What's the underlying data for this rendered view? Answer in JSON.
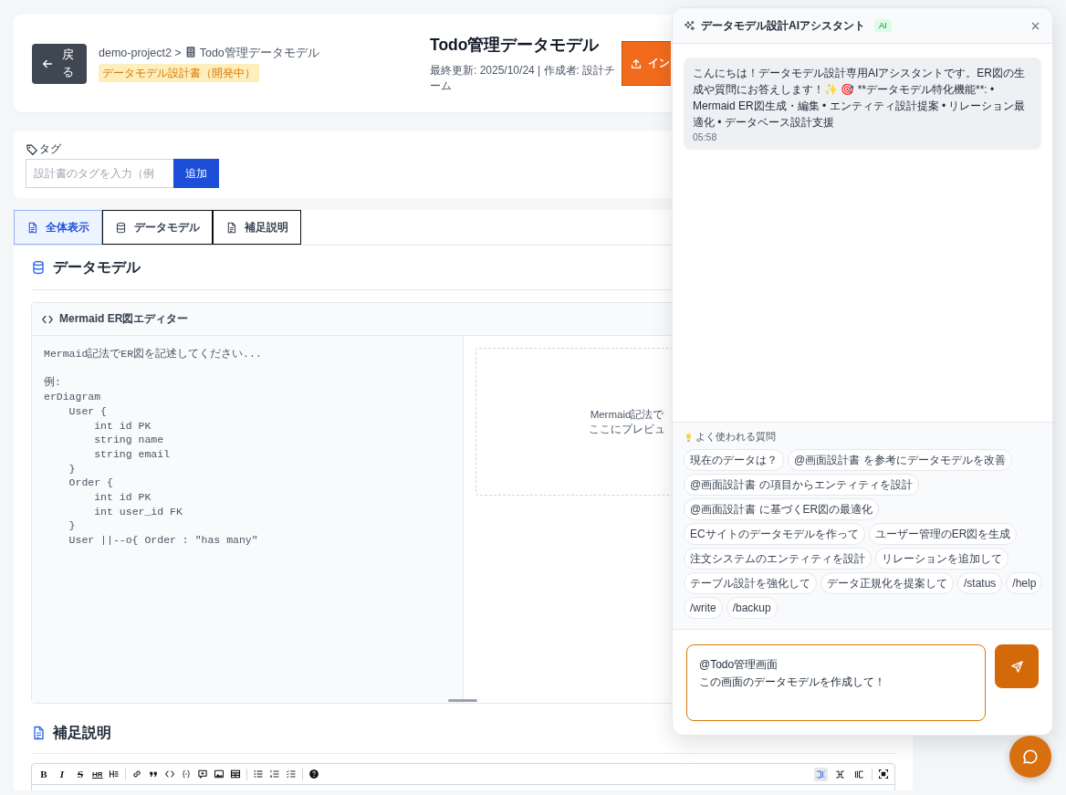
{
  "header": {
    "back_button": "戻る",
    "breadcrumb": {
      "project": "demo-project2 >",
      "document": "Todo管理データモデル"
    },
    "status_badge": "データモデル設計書（開発中）",
    "title": "Todo管理データモデル",
    "meta": "最終更新: 2025/10/24 | 作成者: 設計チーム",
    "export_button": "イン"
  },
  "tags": {
    "label": "タグ",
    "input": {
      "placeholder": "設計書のタグを入力（例"
    },
    "add_button": "追加"
  },
  "tabs": [
    {
      "label": "全体表示",
      "kind": "document",
      "selected": true
    },
    {
      "label": "データモデル",
      "kind": "database",
      "selected": false
    },
    {
      "label": "補足説明",
      "kind": "document",
      "selected": false
    }
  ],
  "data_model": {
    "heading": "データモデル",
    "editor_title": "Mermaid ER図エディター",
    "code": {
      "placeholder": "Mermaid記法でER図を記述してください...\n\n例:\nerDiagram\n    User {\n        int id PK\n        string name\n        string email\n    }\n    Order {\n        int id PK\n        int user_id FK\n    }\n    User ||--o{ Order : \"has many\""
    },
    "preview_lines": [
      "Mermaid記法で",
      "ここにプレビュ"
    ]
  },
  "notes": {
    "heading": "補足説明",
    "toolbar": [
      {
        "kind": "bold",
        "label": "B"
      },
      {
        "kind": "italic",
        "label": "I"
      },
      {
        "kind": "strike",
        "label": "S"
      },
      {
        "kind": "hr",
        "label": "HR"
      },
      {
        "kind": "heading"
      },
      {
        "kind": "divider"
      },
      {
        "kind": "link"
      },
      {
        "kind": "quote"
      },
      {
        "kind": "code"
      },
      {
        "kind": "codeblock"
      },
      {
        "kind": "comment"
      },
      {
        "kind": "image"
      },
      {
        "kind": "table"
      },
      {
        "kind": "divider"
      },
      {
        "kind": "list"
      },
      {
        "kind": "ordered"
      },
      {
        "kind": "tasks"
      },
      {
        "kind": "divider"
      },
      {
        "kind": "help"
      }
    ],
    "view_modes": [
      {
        "kind": "edit",
        "selected": true
      },
      {
        "kind": "live",
        "selected": false
      },
      {
        "kind": "preview",
        "selected": false
      }
    ]
  },
  "assistant": {
    "title": "データモデル設計AIアシスタント",
    "badge": "AI",
    "messages": [
      {
        "text": "こんにちは！データモデル設計専用AIアシスタントです。ER図の生成や質問にお答えします！✨ 🎯 **データモデル特化機能**: • Mermaid ER図生成・編集 • エンティティ設計提案 • リレーション最適化 • データベース設計支援",
        "time": "05:58"
      }
    ],
    "suggestions_label": "よく使われる質問",
    "suggestions": [
      "現在のデータは？",
      "@画面設計書 を参考にデータモデルを改善",
      "@画面設計書 の項目からエンティティを設計",
      "@画面設計書 に基づくER図の最適化",
      "ECサイトのデータモデルを作って",
      "ユーザー管理のER図を生成",
      "注文システムのエンティティを設計",
      "リレーションを追加して",
      "テーブル設計を強化して",
      "データ正規化を提案して",
      "/status",
      "/help",
      "/write",
      "/backup"
    ],
    "input": {
      "lines": [
        "@Todo管理画面",
        "この画面のデータモデルを作成して！"
      ]
    }
  }
}
